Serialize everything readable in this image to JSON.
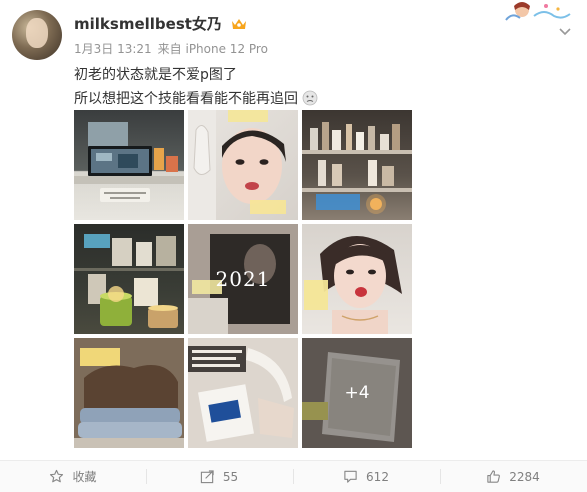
{
  "post": {
    "username": "milksmellbest女乃",
    "date": "1月3日 13:21",
    "source": "来自 iPhone 12 Pro",
    "line1": "初老的状态就是不爱p图了",
    "line2": "所以想把这个技能看看能不能再追回"
  },
  "images": {
    "year_text": "2021",
    "more_count": "+4"
  },
  "icons": {
    "crown": "vip-crown-icon",
    "expand": "chevron-down-icon",
    "emoji": "sad-face-emoji-icon",
    "favorite": "star-icon",
    "repost": "share-icon",
    "comment": "comment-icon",
    "like": "thumbs-up-icon"
  },
  "actions": {
    "favorite_label": "收藏",
    "repost_count": "55",
    "comment_count": "612",
    "like_count": "2284"
  },
  "colors": {
    "text": "#333333",
    "meta": "#939393",
    "action": "#808080",
    "crown": "#f7a51c"
  }
}
